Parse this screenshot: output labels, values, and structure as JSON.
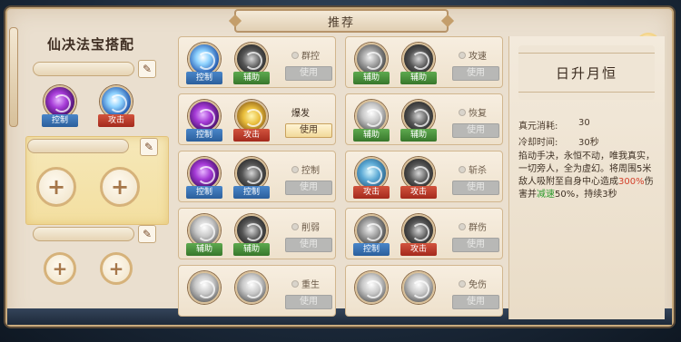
{
  "header": {
    "title": "推荐"
  },
  "left": {
    "title": "仙决法宝搭配",
    "sets": [
      {
        "name": "",
        "skills": [
          {
            "orb": "purple",
            "tag": "控制",
            "tag_color": "blue",
            "icon": "purple-vortex-icon"
          },
          {
            "orb": "blue",
            "tag": "攻击",
            "tag_color": "red",
            "icon": "lightning-burst-icon"
          }
        ]
      },
      {
        "name": "",
        "slots": [
          "+",
          "+"
        ]
      },
      {
        "name": "",
        "slots": [
          "+",
          "+"
        ]
      }
    ],
    "edit_icon": "pencil-icon"
  },
  "cards": [
    {
      "left": {
        "orb": "blue",
        "tag": "控制",
        "tag_color": "blue",
        "icon": "lightning-orb-icon"
      },
      "right": {
        "orb": "dark",
        "tag": "辅助",
        "tag_color": "green",
        "icon": "shadow-swirl-icon"
      },
      "label": "群控",
      "active": false,
      "button": "使用",
      "button_on": false
    },
    {
      "left": {
        "orb": "gray",
        "tag": "辅助",
        "tag_color": "green",
        "icon": "claw-strike-icon"
      },
      "right": {
        "orb": "dark",
        "tag": "辅助",
        "tag_color": "green",
        "icon": "ghost-mask-icon"
      },
      "label": "攻速",
      "active": false,
      "button": "使用",
      "button_on": false
    },
    {
      "left": {
        "orb": "purple",
        "tag": "控制",
        "tag_color": "blue",
        "icon": "purple-vortex-icon"
      },
      "right": {
        "orb": "gold",
        "tag": "攻击",
        "tag_color": "red",
        "icon": "golden-bell-icon"
      },
      "label": "爆发",
      "active": true,
      "button": "使用",
      "button_on": true
    },
    {
      "left": {
        "orb": "white",
        "tag": "辅助",
        "tag_color": "green",
        "icon": "lotus-icon"
      },
      "right": {
        "orb": "dark",
        "tag": "辅助",
        "tag_color": "green",
        "icon": "moon-swirl-icon"
      },
      "label": "恢复",
      "active": false,
      "button": "使用",
      "button_on": false
    },
    {
      "left": {
        "orb": "purple",
        "tag": "控制",
        "tag_color": "blue",
        "icon": "purple-vortex-icon"
      },
      "right": {
        "orb": "dark",
        "tag": "控制",
        "tag_color": "blue",
        "icon": "dark-hand-icon"
      },
      "label": "控制",
      "active": false,
      "button": "使用",
      "button_on": false
    },
    {
      "left": {
        "orb": "cyan",
        "tag": "攻击",
        "tag_color": "red",
        "icon": "ice-blast-icon"
      },
      "right": {
        "orb": "dark",
        "tag": "攻击",
        "tag_color": "red",
        "icon": "black-vortex-icon"
      },
      "label": "斩杀",
      "active": false,
      "button": "使用",
      "button_on": false
    },
    {
      "left": {
        "orb": "white",
        "tag": "辅助",
        "tag_color": "green",
        "icon": "sword-ring-icon"
      },
      "right": {
        "orb": "dark",
        "tag": "辅助",
        "tag_color": "green",
        "icon": "wind-swirl-icon"
      },
      "label": "削弱",
      "active": false,
      "button": "使用",
      "button_on": false
    },
    {
      "left": {
        "orb": "gray",
        "tag": "控制",
        "tag_color": "blue",
        "icon": "blade-storm-icon"
      },
      "right": {
        "orb": "dark",
        "tag": "攻击",
        "tag_color": "red",
        "icon": "rock-fist-icon"
      },
      "label": "群伤",
      "active": false,
      "button": "使用",
      "button_on": false
    },
    {
      "left": {
        "orb": "white",
        "tag": "",
        "tag_color": "plain",
        "icon": "figure-silhouette-icon"
      },
      "right": {
        "orb": "white",
        "tag": "",
        "tag_color": "plain",
        "icon": "radiant-star-icon"
      },
      "label": "重生",
      "active": false,
      "button": "使用",
      "button_on": false
    },
    {
      "left": {
        "orb": "white",
        "tag": "",
        "tag_color": "plain",
        "icon": "comet-icon"
      },
      "right": {
        "orb": "white",
        "tag": "",
        "tag_color": "plain",
        "icon": "thunder-spark-icon"
      },
      "label": "免伤",
      "active": false,
      "button": "使用",
      "button_on": false
    }
  ],
  "detail": {
    "title": "日升月恒",
    "stats": [
      {
        "label": "真元消耗:",
        "value": "30"
      },
      {
        "label": "冷却时间:",
        "value": "30秒"
      }
    ],
    "desc_parts": [
      {
        "text": "掐动手决，永恒不动，唯我真实，一切旁人，全为虚幻。将周围5米敌人吸附至自身中心造成",
        "cls": ""
      },
      {
        "text": "300%",
        "cls": "hl-red"
      },
      {
        "text": "伤害并",
        "cls": ""
      },
      {
        "text": "减速",
        "cls": "hl-green"
      },
      {
        "text": "50%，持续3秒",
        "cls": ""
      }
    ]
  },
  "close": {
    "label": "×"
  }
}
